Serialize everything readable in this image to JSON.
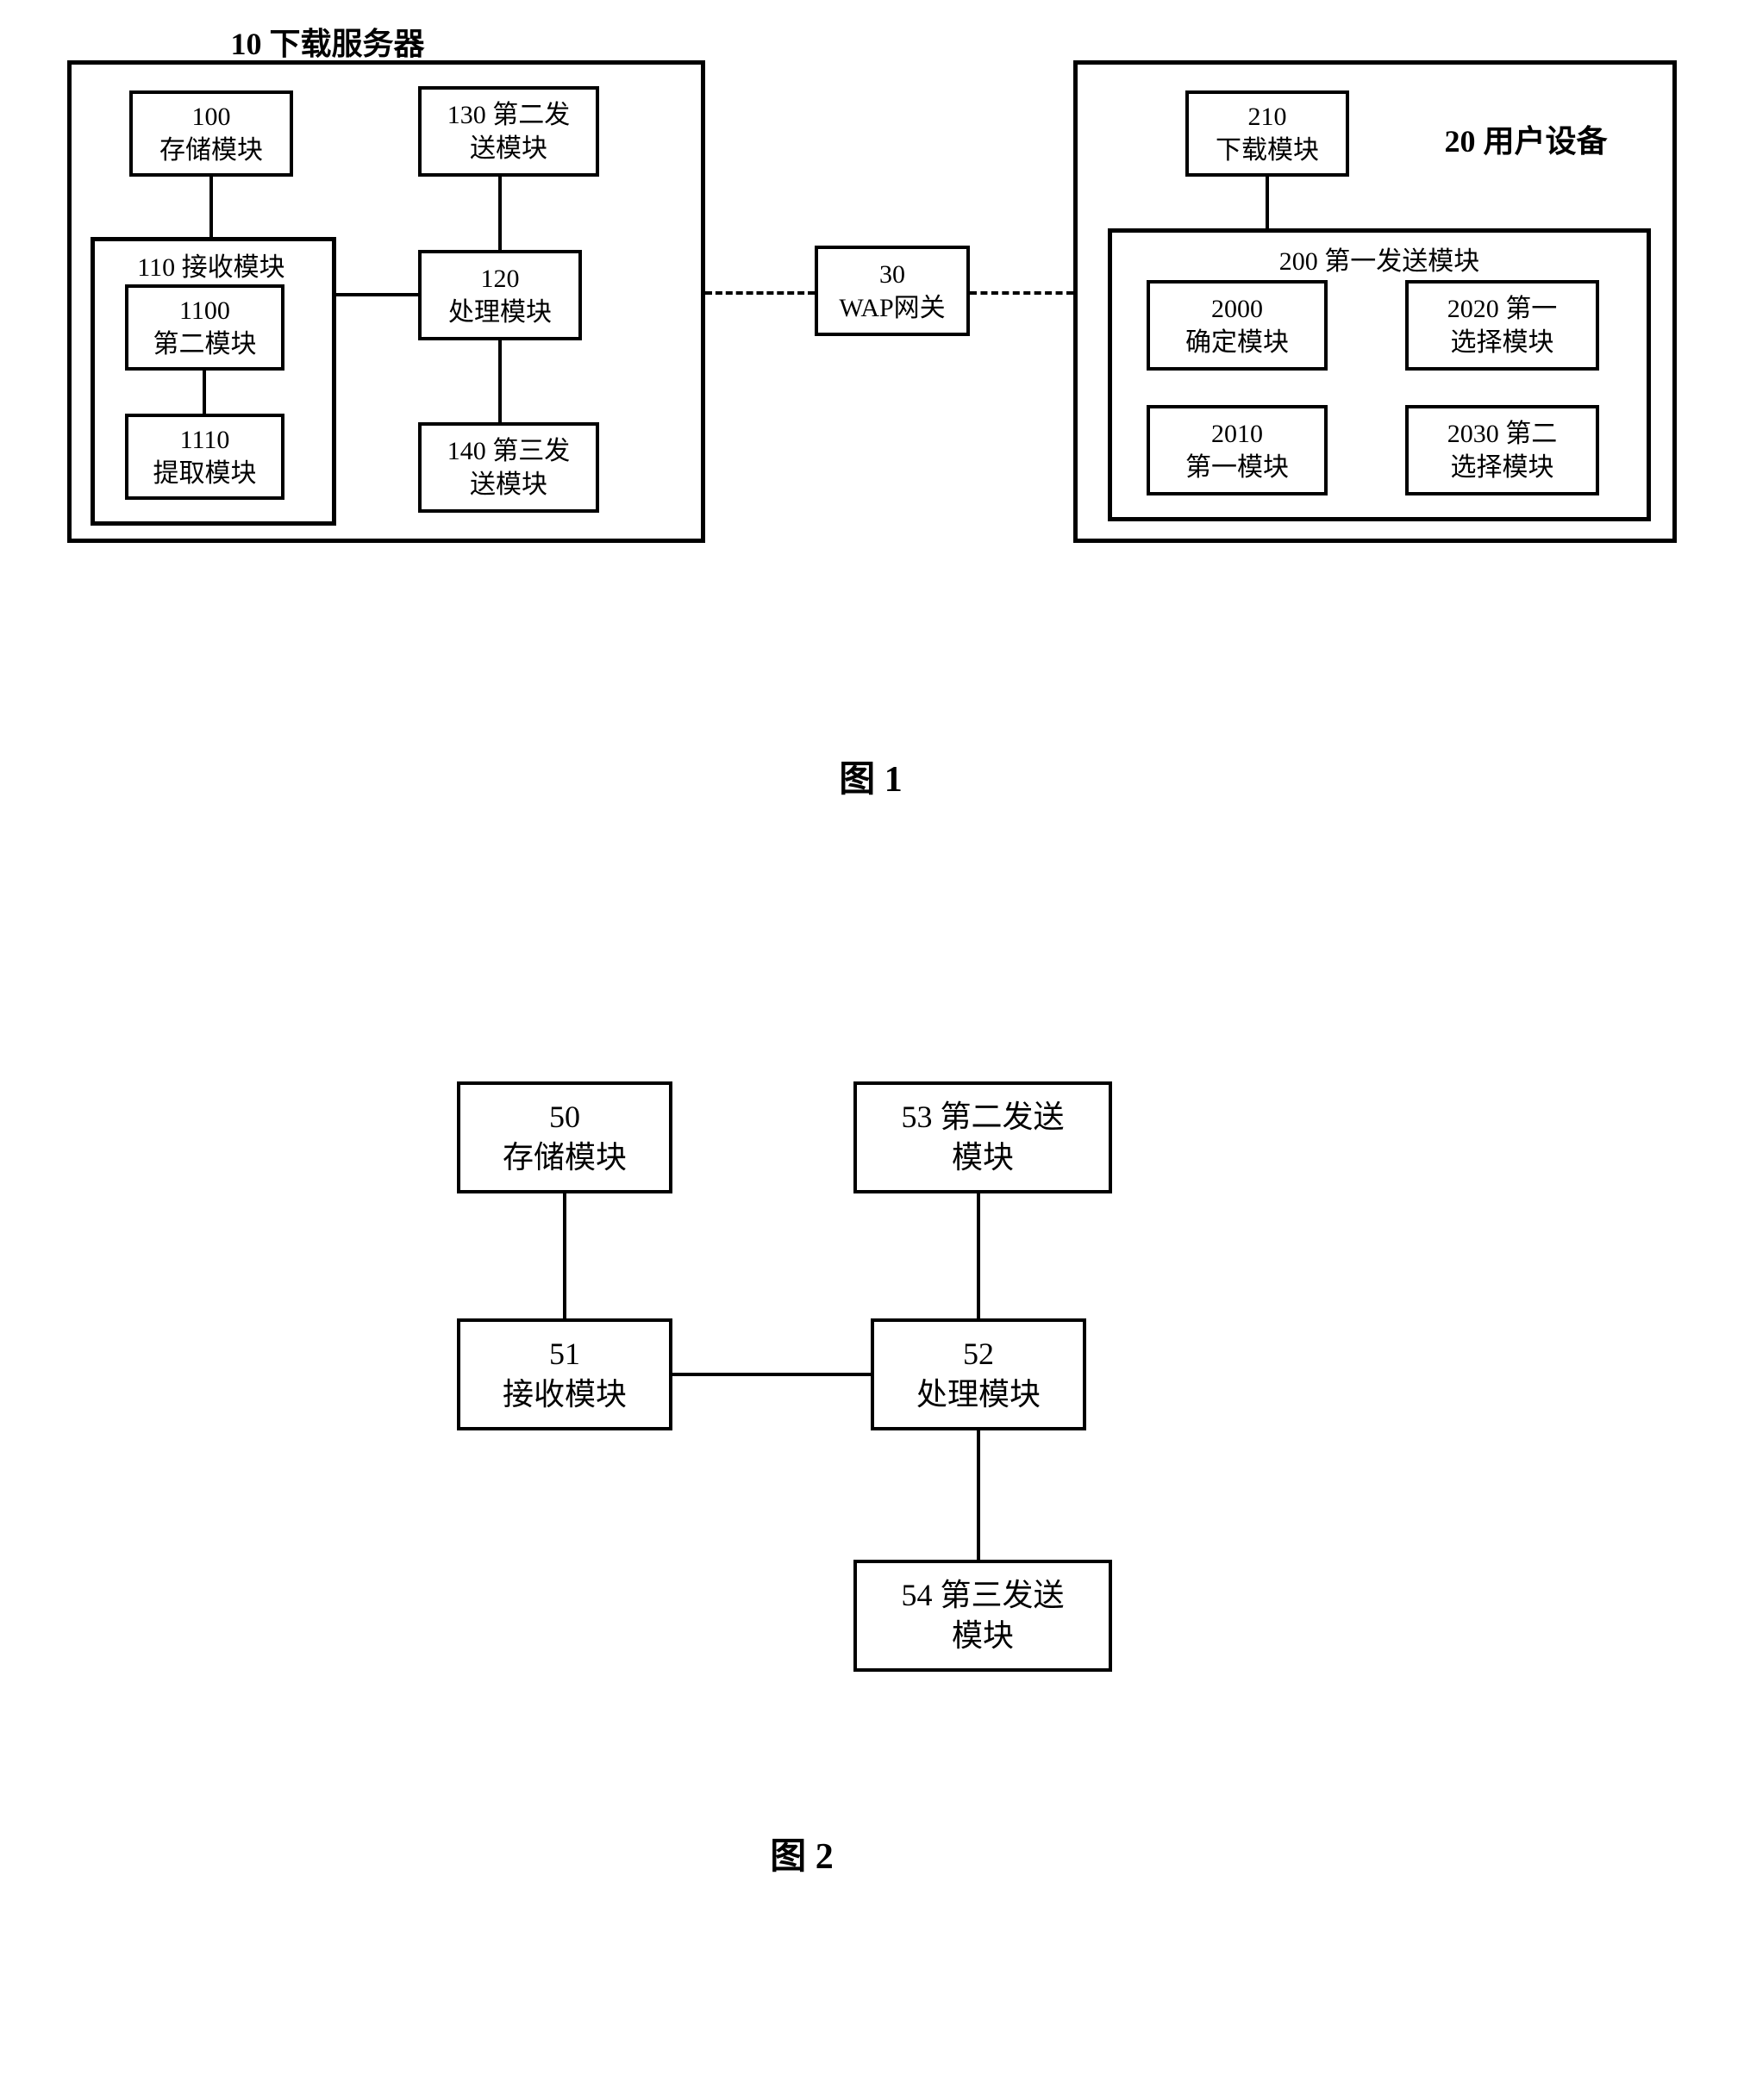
{
  "fig1": {
    "label": "图 1",
    "server": {
      "title": "10 下载服务器",
      "b100": {
        "num": "100",
        "name": "存储模块"
      },
      "b110": {
        "title": "110 接收模块",
        "b1100": {
          "num": "1100",
          "name": "第二模块"
        },
        "b1110": {
          "num": "1110",
          "name": "提取模块"
        }
      },
      "b120": {
        "num": "120",
        "name": "处理模块"
      },
      "b130": {
        "num": "130 第二发",
        "name": "送模块"
      },
      "b140": {
        "num": "140 第三发",
        "name": "送模块"
      }
    },
    "gateway": {
      "num": "30",
      "name": "WAP网关"
    },
    "ue": {
      "title": "20 用户设备",
      "b210": {
        "num": "210",
        "name": "下载模块"
      },
      "b200": {
        "title": "200 第一发送模块",
        "b2000": {
          "num": "2000",
          "name": "确定模块"
        },
        "b2010": {
          "num": "2010",
          "name": "第一模块"
        },
        "b2020": {
          "num": "2020 第一",
          "name": "选择模块"
        },
        "b2030": {
          "num": "2030 第二",
          "name": "选择模块"
        }
      }
    }
  },
  "fig2": {
    "label": "图 2",
    "b50": {
      "num": "50",
      "name": "存储模块"
    },
    "b51": {
      "num": "51",
      "name": "接收模块"
    },
    "b52": {
      "num": "52",
      "name": "处理模块"
    },
    "b53": {
      "num": "53 第二发送",
      "name": "模块"
    },
    "b54": {
      "num": "54 第三发送",
      "name": "模块"
    }
  }
}
